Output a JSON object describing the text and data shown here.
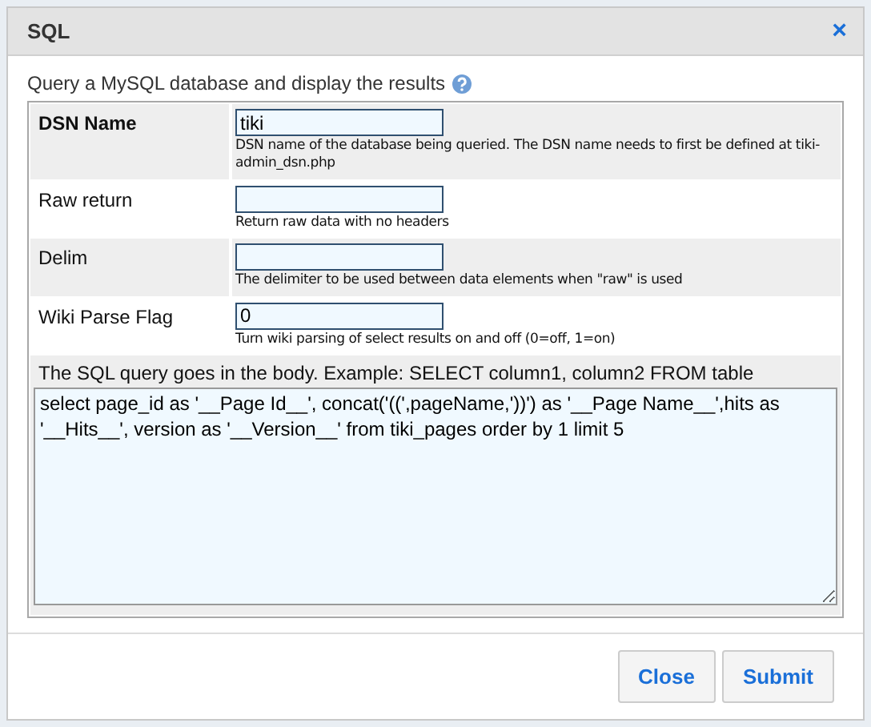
{
  "dialog": {
    "title": "SQL",
    "close_glyph": "×"
  },
  "intro": "Query a MySQL database and display the results",
  "params": [
    {
      "label": "DSN Name",
      "required": true,
      "value": "tiki",
      "description": "DSN name of the database being queried. The DSN name needs to first be defined at tiki-admin_dsn.php"
    },
    {
      "label": "Raw return",
      "required": false,
      "description": "Return raw data with no headers"
    },
    {
      "label": "Delim",
      "required": false,
      "description": "The delimiter to be used between data elements when \"raw\" is used"
    },
    {
      "label": "Wiki Parse Flag",
      "required": false,
      "value": "0",
      "description": "Turn wiki parsing of select results on and off (0=off, 1=on)"
    }
  ],
  "body": {
    "label": "The SQL query goes in the body. Example: SELECT column1, column2 FROM table",
    "value": "select page_id as '__Page Id__', concat('((',pageName,'))') as '__Page Name__',hits as '__Hits__', version as '__Version__' from tiki_pages order by 1 limit 5"
  },
  "buttons": [
    "Close",
    "Submit"
  ]
}
